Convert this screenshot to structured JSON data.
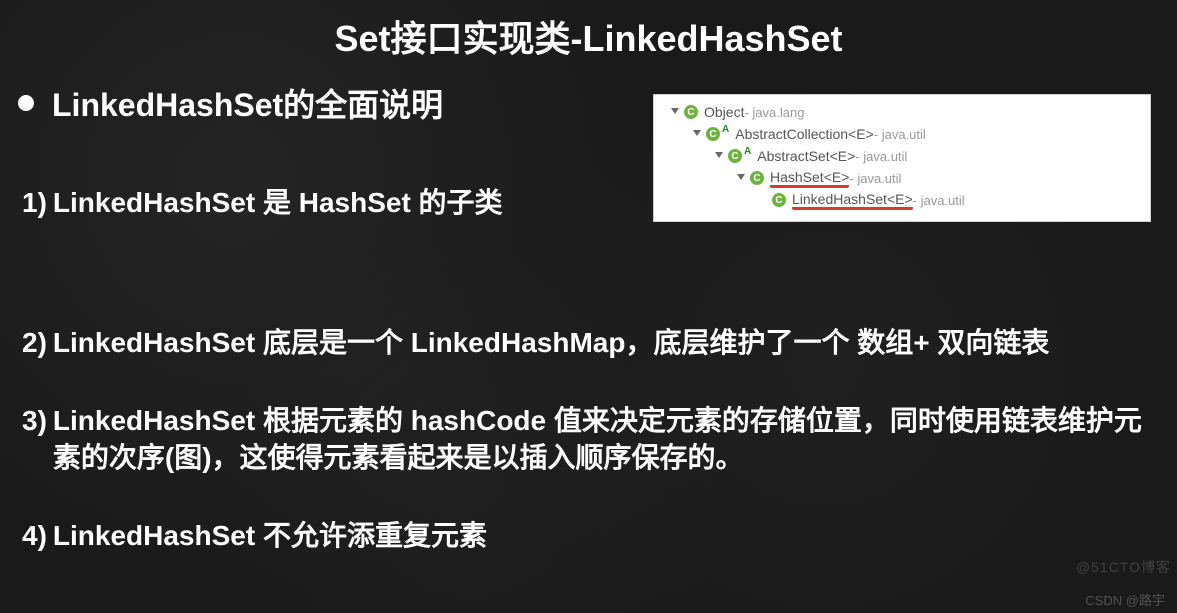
{
  "title": "Set接口实现类-LinkedHashSet",
  "subtitle": "LinkedHashSet的全面说明",
  "points": [
    {
      "num": "1)",
      "text": "LinkedHashSet 是 HashSet 的子类"
    },
    {
      "num": "2)",
      "text": "LinkedHashSet 底层是一个 LinkedHashMap，底层维护了一个 数组+ 双向链表"
    },
    {
      "num": "3)",
      "text": "LinkedHashSet 根据元素的 hashCode 值来决定元素的存储位置，同时使用链表维护元素的次序(图)，这使得元素看起来是以插入顺序保存的。"
    },
    {
      "num": "4)",
      "text": "LinkedHashSet 不允许添重复元素"
    }
  ],
  "hierarchy": {
    "rows": [
      {
        "indent": 0,
        "iconLetter": "C",
        "abstract": false,
        "name": "Object",
        "pkg": "java.lang",
        "underline": false
      },
      {
        "indent": 1,
        "iconLetter": "C",
        "abstract": true,
        "name": "AbstractCollection<E>",
        "pkg": "java.util",
        "underline": false
      },
      {
        "indent": 2,
        "iconLetter": "C",
        "abstract": true,
        "name": "AbstractSet<E>",
        "pkg": "java.util",
        "underline": false
      },
      {
        "indent": 3,
        "iconLetter": "C",
        "abstract": false,
        "name": "HashSet<E>",
        "pkg": "java.util",
        "underline": true
      },
      {
        "indent": 4,
        "iconLetter": "C",
        "abstract": false,
        "name": "LinkedHashSet<E>",
        "pkg": "java.util",
        "underline": true
      }
    ]
  },
  "watermarks": {
    "right": "@51CTO博客",
    "bottom": "CSDN @路宇"
  }
}
